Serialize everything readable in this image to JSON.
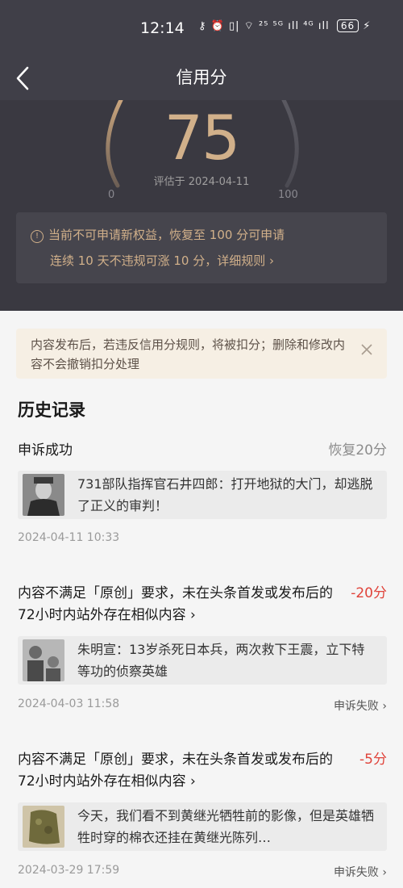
{
  "status_bar": {
    "time": "12:14",
    "icons_text": "⚷ ⏰ ▯| ⌔ ²⁵ ⁵ᴳ ıll ⁴ᴳ ıll",
    "battery": "66",
    "charging": "⚡"
  },
  "header": {
    "back_icon": "back-arrow-icon",
    "title": "信用分"
  },
  "score": {
    "value": "75",
    "date_label": "评估于 2024-04-11",
    "gauge_min": "0",
    "gauge_max": "100"
  },
  "notice": {
    "line1": "当前不可申请新权益，恢复至 100 分可申请",
    "line2": "连续 10 天不违规可涨 10 分，详细规则 ›"
  },
  "warning": {
    "text": "内容发布后，若违反信用分规则，将被扣分；删除和修改内容不会撤销扣分处理"
  },
  "history": {
    "title": "历史记录",
    "records": [
      {
        "title": "申诉成功",
        "score": "恢复20分",
        "card_text": "731部队指挥官石井四郎：打开地狱的大门，却逃脱了正义的审判！",
        "time": "2024-04-11 10:33",
        "appeal": ""
      },
      {
        "title": "内容不满足「原创」要求，未在头条首发或发布后的72小时内站外存在相似内容 ›",
        "score": "-20分",
        "card_text": "朱明宣：13岁杀死日本兵，两次救下王震，立下特等功的侦察英雄",
        "time": "2024-04-03 11:58",
        "appeal": "申诉失败 ›"
      },
      {
        "title": "内容不满足「原创」要求，未在头条首发或发布后的72小时内站外存在相似内容 ›",
        "score": "-5分",
        "card_text": "今天，我们看不到黄继光牺牲前的影像，但是英雄牺牲时穿的棉衣还挂在黄继光陈列…",
        "time": "2024-03-29 17:59",
        "appeal": "申诉失败 ›"
      }
    ]
  },
  "colors": {
    "header_bg": "#3a3941",
    "accent_gold": "#d1b08a",
    "negative": "#e0433a"
  }
}
